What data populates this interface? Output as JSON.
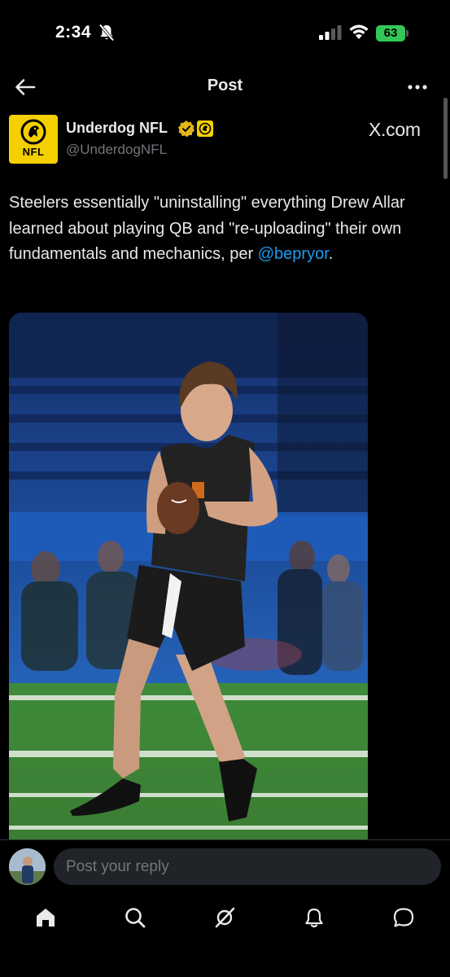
{
  "status_bar": {
    "time": "2:34",
    "battery": "63"
  },
  "header": {
    "title": "Post"
  },
  "author": {
    "name": "Underdog NFL",
    "handle": "@UnderdogNFL",
    "avatar_text": "NFL",
    "source_label": "X.com"
  },
  "tweet": {
    "text": "Steelers essentially \"uninstalling\" everything Drew Allar learned about playing QB and \"re-uploading\" their own fundamentals and mechanics, per ",
    "mention": "@bepryor",
    "suffix": "."
  },
  "reply": {
    "placeholder": "Post your reply"
  },
  "colors": {
    "accent": "#1d9bf0",
    "badge_gold": "#f5d000",
    "battery_green": "#33c759"
  }
}
